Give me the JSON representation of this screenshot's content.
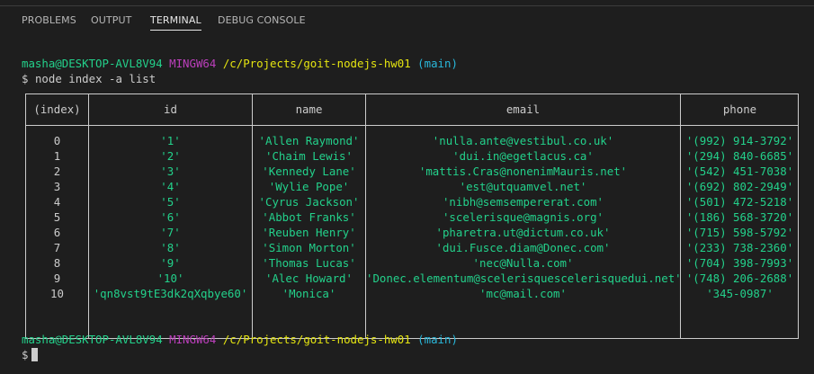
{
  "tabs": [
    {
      "label": "PROBLEMS"
    },
    {
      "label": "OUTPUT"
    },
    {
      "label": "TERMINAL"
    },
    {
      "label": "DEBUG CONSOLE"
    }
  ],
  "active_tab": "TERMINAL",
  "prompt": {
    "user": "masha@DESKTOP-AVL8V94",
    "host": "MINGW64",
    "path": "/c/Projects/goit-nodejs-hw01",
    "branch": "(main)",
    "symbol": "$"
  },
  "command": "node index -a list",
  "table": {
    "headers": [
      "(index)",
      "id",
      "name",
      "email",
      "phone"
    ],
    "rows": [
      {
        "index": "0",
        "id": "'1'",
        "name": "'Allen Raymond'",
        "email": "'nulla.ante@vestibul.co.uk'",
        "phone": "'(992) 914-3792'"
      },
      {
        "index": "1",
        "id": "'2'",
        "name": "'Chaim Lewis'",
        "email": "'dui.in@egetlacus.ca'",
        "phone": "'(294) 840-6685'"
      },
      {
        "index": "2",
        "id": "'3'",
        "name": "'Kennedy Lane'",
        "email": "'mattis.Cras@nonenimMauris.net'",
        "phone": "'(542) 451-7038'"
      },
      {
        "index": "3",
        "id": "'4'",
        "name": "'Wylie Pope'",
        "email": "'est@utquamvel.net'",
        "phone": "'(692) 802-2949'"
      },
      {
        "index": "4",
        "id": "'5'",
        "name": "'Cyrus Jackson'",
        "email": "'nibh@semsempererat.com'",
        "phone": "'(501) 472-5218'"
      },
      {
        "index": "5",
        "id": "'6'",
        "name": "'Abbot Franks'",
        "email": "'scelerisque@magnis.org'",
        "phone": "'(186) 568-3720'"
      },
      {
        "index": "6",
        "id": "'7'",
        "name": "'Reuben Henry'",
        "email": "'pharetra.ut@dictum.co.uk'",
        "phone": "'(715) 598-5792'"
      },
      {
        "index": "7",
        "id": "'8'",
        "name": "'Simon Morton'",
        "email": "'dui.Fusce.diam@Donec.com'",
        "phone": "'(233) 738-2360'"
      },
      {
        "index": "8",
        "id": "'9'",
        "name": "'Thomas Lucas'",
        "email": "'nec@Nulla.com'",
        "phone": "'(704) 398-7993'"
      },
      {
        "index": "9",
        "id": "'10'",
        "name": "'Alec Howard'",
        "email": "'Donec.elementum@scelerisquescelerisquedui.net'",
        "phone": "'(748) 206-2688'"
      },
      {
        "index": "10",
        "id": "'qn8vst9tE3dk2qXqbye60'",
        "name": "'Monica'",
        "email": "'mc@mail.com'",
        "phone": "'345-0987'"
      }
    ]
  },
  "colors": {
    "background": "#1e1e1e",
    "text": "#cccccc",
    "user": "#23d18b",
    "host": "#bc3fbc",
    "path": "#e5e510",
    "branch": "#29b8db",
    "string": "#23d18b"
  }
}
